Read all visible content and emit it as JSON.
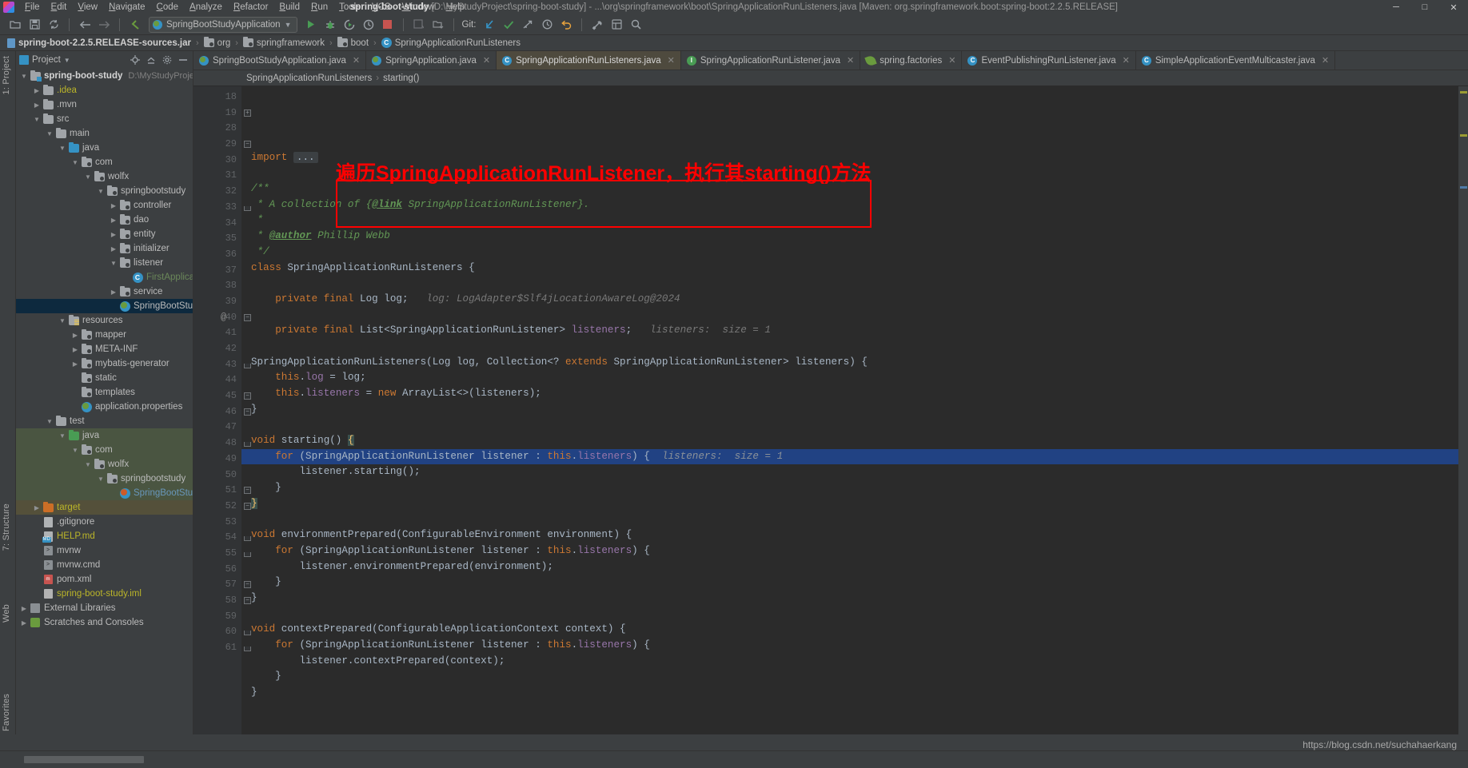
{
  "titlebar": {
    "menus": [
      "File",
      "Edit",
      "View",
      "Navigate",
      "Code",
      "Analyze",
      "Refactor",
      "Build",
      "Run",
      "Tools",
      "VCS",
      "Window",
      "Help"
    ],
    "project_name": "spring-boot-study",
    "path_info": "[D:\\MyStudyProject\\spring-boot-study] - ...\\org\\springframework\\boot\\SpringApplicationRunListeners.java [Maven: org.springframework.boot:spring-boot:2.2.5.RELEASE]",
    "minimize": "─",
    "maximize": "□",
    "close": "✕"
  },
  "toolbar": {
    "open_icon": "open-folder-icon",
    "save_icon": "save-icon",
    "sync_icon": "sync-icon",
    "back_icon": "back-arrow-icon",
    "forward_icon": "forward-arrow-icon",
    "undo_icon": "undo-arrow-icon",
    "run_config": "SpringBootStudyApplication",
    "run_label": "Run",
    "debug_label": "Debug",
    "stop_label": "Stop",
    "git_label": "Git:",
    "update_label": "Update Project",
    "commit_label": "Commit",
    "push_label": "Push",
    "history_label": "History",
    "rollback_label": "Rollback",
    "settings_label": "Settings",
    "search_label": "Search Everywhere"
  },
  "navbar": {
    "crumbs": [
      {
        "label": "spring-boot-2.2.5.RELEASE-sources.jar",
        "icon": "jar-icon"
      },
      {
        "label": "org",
        "icon": "folder-icon"
      },
      {
        "label": "springframework",
        "icon": "folder-icon"
      },
      {
        "label": "boot",
        "icon": "folder-icon"
      },
      {
        "label": "SpringApplicationRunListeners",
        "icon": "class-icon"
      }
    ],
    "separator": "›"
  },
  "project_panel": {
    "title": "Project",
    "dropdown": "▾",
    "icons": [
      "collapse-all-icon",
      "target-icon",
      "settings-icon",
      "hide-icon"
    ],
    "tree": [
      {
        "depth": 0,
        "label": "spring-boot-study",
        "sub": "D:\\MyStudyProject",
        "arrow": "down",
        "icon": "module-folder",
        "bold": true
      },
      {
        "depth": 1,
        "label": ".idea",
        "arrow": "right",
        "icon": "folder",
        "color": "yel"
      },
      {
        "depth": 1,
        "label": ".mvn",
        "arrow": "right",
        "icon": "folder"
      },
      {
        "depth": 1,
        "label": "src",
        "arrow": "down",
        "icon": "folder"
      },
      {
        "depth": 2,
        "label": "main",
        "arrow": "down",
        "icon": "folder"
      },
      {
        "depth": 3,
        "label": "java",
        "arrow": "down",
        "icon": "folder-blue"
      },
      {
        "depth": 4,
        "label": "com",
        "arrow": "down",
        "icon": "folder-src"
      },
      {
        "depth": 5,
        "label": "wolfx",
        "arrow": "down",
        "icon": "folder-src"
      },
      {
        "depth": 6,
        "label": "springbootstudy",
        "arrow": "down",
        "icon": "folder-src"
      },
      {
        "depth": 7,
        "label": "controller",
        "arrow": "right",
        "icon": "folder-src"
      },
      {
        "depth": 7,
        "label": "dao",
        "arrow": "right",
        "icon": "folder-src"
      },
      {
        "depth": 7,
        "label": "entity",
        "arrow": "right",
        "icon": "folder-src"
      },
      {
        "depth": 7,
        "label": "initializer",
        "arrow": "right",
        "icon": "folder-src"
      },
      {
        "depth": 7,
        "label": "listener",
        "arrow": "down",
        "icon": "folder-src"
      },
      {
        "depth": 8,
        "label": "FirstApplicatio",
        "arrow": "none",
        "icon": "class",
        "color": "grn"
      },
      {
        "depth": 7,
        "label": "service",
        "arrow": "right",
        "icon": "folder-src"
      },
      {
        "depth": 7,
        "label": "SpringBootStudy",
        "arrow": "none",
        "icon": "spring",
        "selected": true
      },
      {
        "depth": 3,
        "label": "resources",
        "arrow": "down",
        "icon": "folder-res"
      },
      {
        "depth": 4,
        "label": "mapper",
        "arrow": "right",
        "icon": "folder-src"
      },
      {
        "depth": 4,
        "label": "META-INF",
        "arrow": "right",
        "icon": "folder-src"
      },
      {
        "depth": 4,
        "label": "mybatis-generator",
        "arrow": "right",
        "icon": "folder-src"
      },
      {
        "depth": 4,
        "label": "static",
        "arrow": "none",
        "icon": "folder-src"
      },
      {
        "depth": 4,
        "label": "templates",
        "arrow": "none",
        "icon": "folder-src"
      },
      {
        "depth": 4,
        "label": "application.properties",
        "arrow": "none",
        "icon": "spring-props"
      },
      {
        "depth": 2,
        "label": "test",
        "arrow": "down",
        "icon": "folder"
      },
      {
        "depth": 3,
        "label": "java",
        "arrow": "down",
        "icon": "folder-green",
        "hl": "test"
      },
      {
        "depth": 4,
        "label": "com",
        "arrow": "down",
        "icon": "folder-src",
        "hl": "test"
      },
      {
        "depth": 5,
        "label": "wolfx",
        "arrow": "down",
        "icon": "folder-src",
        "hl": "test"
      },
      {
        "depth": 6,
        "label": "springbootstudy",
        "arrow": "down",
        "icon": "folder-src",
        "hl": "test"
      },
      {
        "depth": 7,
        "label": "SpringBootStudy",
        "arrow": "none",
        "icon": "spring-red",
        "color": "blu",
        "hl": "test"
      },
      {
        "depth": 1,
        "label": "target",
        "arrow": "right",
        "icon": "folder-orange",
        "color": "yel",
        "hl": "target"
      },
      {
        "depth": 1,
        "label": ".gitignore",
        "arrow": "none",
        "icon": "file"
      },
      {
        "depth": 1,
        "label": "HELP.md",
        "arrow": "none",
        "icon": "file-md",
        "color": "yel"
      },
      {
        "depth": 1,
        "label": "mvnw",
        "arrow": "none",
        "icon": "file-script"
      },
      {
        "depth": 1,
        "label": "mvnw.cmd",
        "arrow": "none",
        "icon": "file-script"
      },
      {
        "depth": 1,
        "label": "pom.xml",
        "arrow": "none",
        "icon": "file-maven"
      },
      {
        "depth": 1,
        "label": "spring-boot-study.iml",
        "arrow": "none",
        "icon": "file-iml",
        "color": "yel"
      },
      {
        "depth": 0,
        "label": "External Libraries",
        "arrow": "right",
        "icon": "lib"
      },
      {
        "depth": 0,
        "label": "Scratches and Consoles",
        "arrow": "right",
        "icon": "scratch"
      }
    ]
  },
  "tool_strips": {
    "left_top": "1: Project",
    "left_structure": "7: Structure",
    "left_web": "Web",
    "left_favorites": "Favorites"
  },
  "editor": {
    "tabs": [
      {
        "label": "SpringBootStudyApplication.java",
        "icon": "spring-icon",
        "active": false
      },
      {
        "label": "SpringApplication.java",
        "icon": "spring-icon",
        "active": false
      },
      {
        "label": "SpringApplicationRunListeners.java",
        "icon": "class-icon",
        "active": true
      },
      {
        "label": "SpringApplicationRunListener.java",
        "icon": "interface-icon",
        "active": false
      },
      {
        "label": "spring.factories",
        "icon": "leaf-icon",
        "active": false
      },
      {
        "label": "EventPublishingRunListener.java",
        "icon": "class-icon",
        "active": false
      },
      {
        "label": "SimpleApplicationEventMulticaster.java",
        "icon": "class-icon",
        "active": false
      }
    ],
    "close_glyph": "✕",
    "breadcrumb": [
      "SpringApplicationRunListeners",
      "starting()"
    ],
    "breadcrumb_sep": "›",
    "line_numbers": [
      18,
      19,
      28,
      29,
      30,
      31,
      32,
      33,
      34,
      35,
      36,
      37,
      38,
      39,
      40,
      41,
      42,
      43,
      44,
      45,
      46,
      47,
      48,
      49,
      50,
      51,
      52,
      53,
      54,
      55,
      56,
      57,
      58,
      59,
      60,
      61
    ],
    "annotation": "遍历SpringApplicationRunListener，执行其starting()方法",
    "annotation_color": "#ff0000",
    "code_lines": [
      {
        "n": 18,
        "segments": []
      },
      {
        "n": 19,
        "segments": [
          {
            "t": "import ",
            "c": "kw"
          },
          {
            "t": "...",
            "c": "folded"
          }
        ],
        "fold": "plus"
      },
      {
        "n": 28,
        "segments": []
      },
      {
        "n": 29,
        "segments": [
          {
            "t": "/**",
            "c": "cmt"
          }
        ],
        "fold": "minus"
      },
      {
        "n": 30,
        "segments": [
          {
            "t": " * A collection of {",
            "c": "cmt"
          },
          {
            "t": "@link",
            "c": "cmtlink"
          },
          {
            "t": " SpringApplicationRunListener}.",
            "c": "cmt"
          }
        ]
      },
      {
        "n": 31,
        "segments": [
          {
            "t": " *",
            "c": "cmt"
          }
        ]
      },
      {
        "n": 32,
        "segments": [
          {
            "t": " * ",
            "c": "cmt"
          },
          {
            "t": "@author",
            "c": "cmtlink"
          },
          {
            "t": " Phillip Webb",
            "c": "cmt"
          }
        ]
      },
      {
        "n": 33,
        "segments": [
          {
            "t": " */",
            "c": "cmt"
          }
        ],
        "fold": "end"
      },
      {
        "n": 34,
        "segments": [
          {
            "t": "class",
            "c": "kw"
          },
          {
            "t": " SpringApplicationRunListeners {",
            "c": ""
          }
        ]
      },
      {
        "n": 35,
        "segments": []
      },
      {
        "n": 36,
        "segments": [
          {
            "t": "    ",
            "c": ""
          },
          {
            "t": "private final",
            "c": "kw"
          },
          {
            "t": " Log log;",
            "c": ""
          },
          {
            "t": "   log: LogAdapter$Slf4jLocationAwareLog@2024",
            "c": "hint"
          }
        ]
      },
      {
        "n": 37,
        "segments": []
      },
      {
        "n": 38,
        "segments": [
          {
            "t": "    ",
            "c": ""
          },
          {
            "t": "private final",
            "c": "kw"
          },
          {
            "t": " List<SpringApplicationRunListener> ",
            "c": ""
          },
          {
            "t": "listeners",
            "c": "fld"
          },
          {
            "t": ";",
            "c": ""
          },
          {
            "t": "   listeners:  size = 1",
            "c": "hint"
          }
        ]
      },
      {
        "n": 39,
        "segments": []
      },
      {
        "n": 40,
        "segments": [
          {
            "t": "SpringApplicationRunListeners(Log log, Collection<? ",
            "c": ""
          },
          {
            "t": "extends",
            "c": "kw"
          },
          {
            "t": " SpringApplicationRunListener> listeners) {",
            "c": ""
          }
        ],
        "at": "@",
        "fold": "minus"
      },
      {
        "n": 41,
        "segments": [
          {
            "t": "    ",
            "c": ""
          },
          {
            "t": "this",
            "c": "kw"
          },
          {
            "t": ".",
            "c": ""
          },
          {
            "t": "log",
            "c": "fld"
          },
          {
            "t": " = log;",
            "c": ""
          }
        ]
      },
      {
        "n": 42,
        "segments": [
          {
            "t": "    ",
            "c": ""
          },
          {
            "t": "this",
            "c": "kw"
          },
          {
            "t": ".",
            "c": ""
          },
          {
            "t": "listeners",
            "c": "fld"
          },
          {
            "t": " = ",
            "c": ""
          },
          {
            "t": "new",
            "c": "kw"
          },
          {
            "t": " ArrayList<>(listeners);",
            "c": ""
          }
        ]
      },
      {
        "n": 43,
        "segments": [
          {
            "t": "}",
            "c": ""
          }
        ],
        "fold": "end"
      },
      {
        "n": 44,
        "segments": []
      },
      {
        "n": 45,
        "segments": [
          {
            "t": "void",
            "c": "kw"
          },
          {
            "t": " starting() ",
            "c": ""
          },
          {
            "t": "{",
            "c": "brace"
          }
        ],
        "fold": "minus"
      },
      {
        "n": 46,
        "segments": [
          {
            "t": "    ",
            "c": ""
          },
          {
            "t": "for",
            "c": "kw"
          },
          {
            "t": " (SpringApplicationRunListener listener : ",
            "c": ""
          },
          {
            "t": "this",
            "c": "kw"
          },
          {
            "t": ".",
            "c": ""
          },
          {
            "t": "listeners",
            "c": "fld"
          },
          {
            "t": ") {",
            "c": ""
          },
          {
            "t": "  listeners:  size = 1",
            "c": "hint2"
          }
        ],
        "highlight": true,
        "fold": "minus"
      },
      {
        "n": 47,
        "segments": [
          {
            "t": "        listener.starting();",
            "c": ""
          }
        ]
      },
      {
        "n": 48,
        "segments": [
          {
            "t": "    }",
            "c": ""
          }
        ],
        "fold": "end"
      },
      {
        "n": 49,
        "segments": [
          {
            "t": "}",
            "c": "brace"
          }
        ],
        "fold": "end"
      },
      {
        "n": 50,
        "segments": []
      },
      {
        "n": 51,
        "segments": [
          {
            "t": "void",
            "c": "kw"
          },
          {
            "t": " environmentPrepared(ConfigurableEnvironment environment) {",
            "c": ""
          }
        ],
        "fold": "minus"
      },
      {
        "n": 52,
        "segments": [
          {
            "t": "    ",
            "c": ""
          },
          {
            "t": "for",
            "c": "kw"
          },
          {
            "t": " (SpringApplicationRunListener listener : ",
            "c": ""
          },
          {
            "t": "this",
            "c": "kw"
          },
          {
            "t": ".",
            "c": ""
          },
          {
            "t": "listeners",
            "c": "fld"
          },
          {
            "t": ") {",
            "c": ""
          }
        ],
        "fold": "minus"
      },
      {
        "n": 53,
        "segments": [
          {
            "t": "        listener.environmentPrepared(environment);",
            "c": ""
          }
        ]
      },
      {
        "n": 54,
        "segments": [
          {
            "t": "    }",
            "c": ""
          }
        ],
        "fold": "end"
      },
      {
        "n": 55,
        "segments": [
          {
            "t": "}",
            "c": ""
          }
        ],
        "fold": "end"
      },
      {
        "n": 56,
        "segments": []
      },
      {
        "n": 57,
        "segments": [
          {
            "t": "void",
            "c": "kw"
          },
          {
            "t": " contextPrepared(ConfigurableApplicationContext context) {",
            "c": ""
          }
        ],
        "fold": "minus"
      },
      {
        "n": 58,
        "segments": [
          {
            "t": "    ",
            "c": ""
          },
          {
            "t": "for",
            "c": "kw"
          },
          {
            "t": " (SpringApplicationRunListener listener : ",
            "c": ""
          },
          {
            "t": "this",
            "c": "kw"
          },
          {
            "t": ".",
            "c": ""
          },
          {
            "t": "listeners",
            "c": "fld"
          },
          {
            "t": ") {",
            "c": ""
          }
        ],
        "fold": "minus"
      },
      {
        "n": 59,
        "segments": [
          {
            "t": "        listener.contextPrepared(context);",
            "c": ""
          }
        ]
      },
      {
        "n": 60,
        "segments": [
          {
            "t": "    }",
            "c": ""
          }
        ],
        "fold": "end"
      },
      {
        "n": 61,
        "segments": [
          {
            "t": "}",
            "c": ""
          }
        ],
        "fold": "end"
      }
    ]
  },
  "statusbar": {
    "watermark": "https://blog.csdn.net/suchahaerkang"
  }
}
